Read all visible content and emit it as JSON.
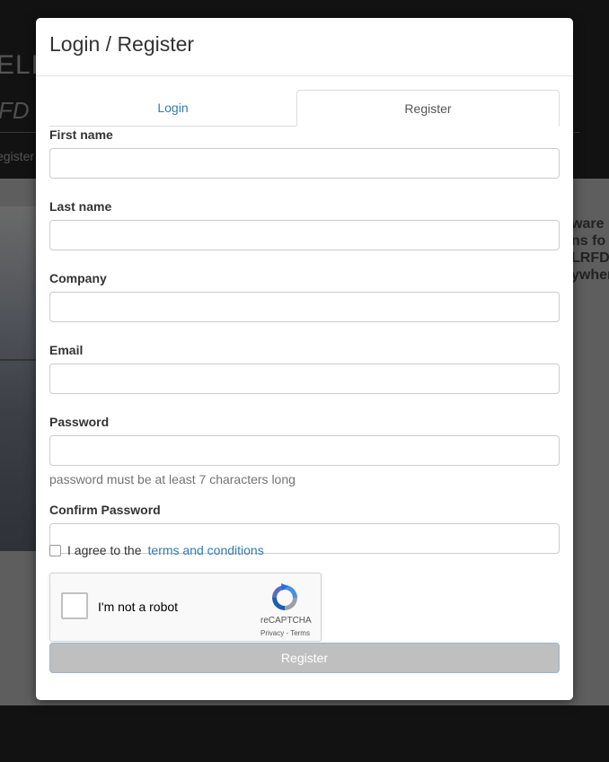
{
  "background": {
    "title_fragment": "ELE",
    "subtitle_fragment": "FD D",
    "nav_fragment": "egister",
    "side_text_lines": [
      "ware p",
      "ns fo",
      "LRFD",
      "ywhere"
    ]
  },
  "modal": {
    "title": "Login / Register",
    "tabs": [
      {
        "label": "Login",
        "active": false
      },
      {
        "label": "Register",
        "active": true
      }
    ],
    "fields": {
      "first_name": {
        "label": "First name",
        "value": ""
      },
      "last_name": {
        "label": "Last name",
        "value": ""
      },
      "company": {
        "label": "Company",
        "value": ""
      },
      "email": {
        "label": "Email",
        "value": ""
      },
      "password": {
        "label": "Password",
        "value": "",
        "help": "password must be at least 7 characters long"
      },
      "confirm_password": {
        "label": "Confirm Password",
        "value": ""
      }
    },
    "agree": {
      "text": "I agree to the",
      "link": "terms and conditions",
      "checked": false
    },
    "captcha": {
      "label": "I'm not a robot",
      "brand": "reCAPTCHA",
      "links": "Privacy - Terms",
      "checked": false
    },
    "register_button": "Register"
  },
  "colors": {
    "link": "#337ab7",
    "button_disabled": "#bfbfbf",
    "overlay": "#121212"
  }
}
